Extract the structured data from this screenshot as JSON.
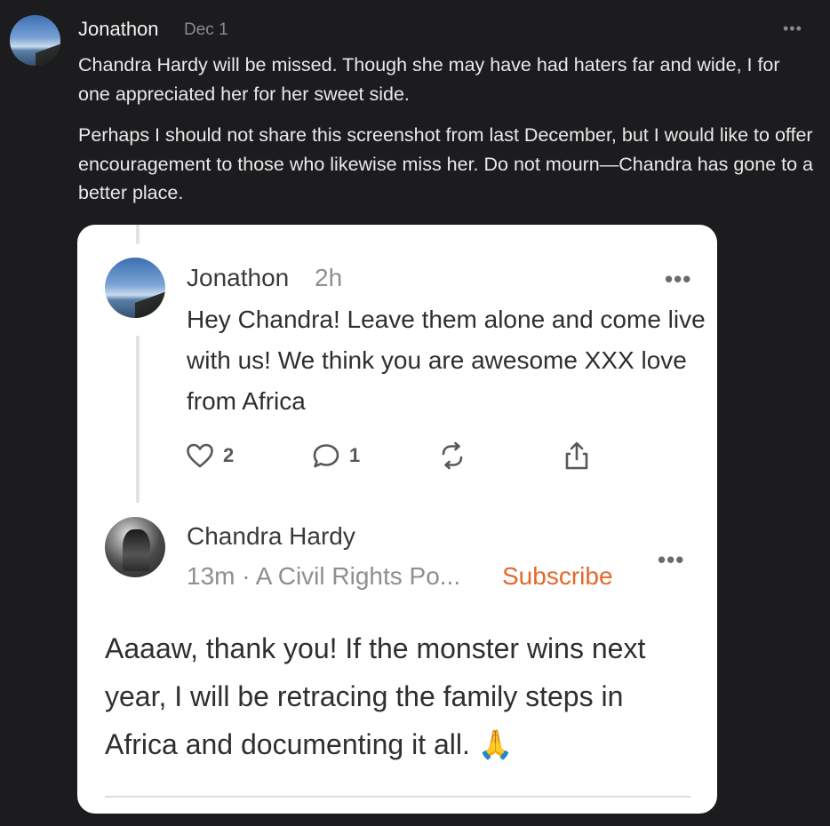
{
  "outer_post": {
    "author": "Jonathon",
    "date": "Dec 1",
    "more_label": "•••",
    "paragraph1": "Chandra Hardy will be missed. Though she may have had haters far and wide, I for one appreciated her for her sweet side.",
    "paragraph2": "Perhaps I should not share this screenshot from last December, but I would like to offer encouragement to those who likewise miss her. Do not mourn—Chandra has gone to a better place."
  },
  "screenshot": {
    "reply1": {
      "author": "Jonathon",
      "time": "2h",
      "more_label": "•••",
      "body": "Hey Chandra! Leave them alone and come live with us! We think you are awesome XXX love from Africa",
      "actions": {
        "likes_count": "2",
        "comments_count": "1"
      }
    },
    "reply2": {
      "author": "Chandra Hardy",
      "meta": "13m · A Civil Rights Po...",
      "subscribe_label": "Subscribe",
      "more_label": "•••",
      "body": "Aaaaw, thank you! If the monster wins next year, I will be retracing the family steps in Africa and documenting it all. 🙏"
    }
  },
  "colors": {
    "background": "#1c1c1e",
    "card": "#ffffff",
    "accent_subscribe": "#e5672a"
  }
}
